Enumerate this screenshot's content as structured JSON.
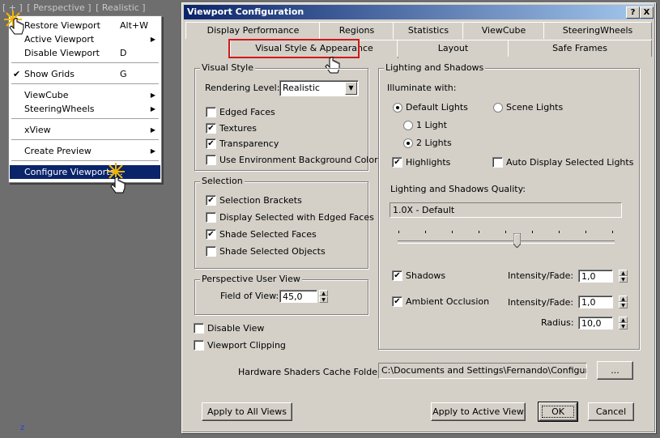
{
  "viewport": {
    "labels": [
      "[ + ]",
      "[ Perspective ]",
      "[ Realistic ]"
    ],
    "axis_label": "z"
  },
  "menu": {
    "items": [
      {
        "label": "Restore Viewport",
        "shortcut": "Alt+W"
      },
      {
        "label": "Active Viewport",
        "submenu_arrow": "▶"
      },
      {
        "label": "Disable Viewport",
        "shortcut": "D"
      },
      {
        "label": "Show Grids",
        "shortcut": "G",
        "check": "✔"
      },
      {
        "label": "ViewCube",
        "submenu_arrow": "▶"
      },
      {
        "label": "SteeringWheels",
        "submenu_arrow": "▶"
      },
      {
        "label": "xView",
        "submenu_arrow": "▶"
      },
      {
        "label": "Create Preview",
        "submenu_arrow": "▶"
      },
      {
        "label": "Configure Viewports..."
      }
    ]
  },
  "dialog": {
    "title": "Viewport Configuration",
    "help_button": "?",
    "close_button": "X",
    "tabs_row1": [
      "Display Performance",
      "Regions",
      "Statistics",
      "ViewCube",
      "SteeringWheels"
    ],
    "tabs_row2": [
      "Visual Style & Appearance",
      "Layout",
      "Safe Frames"
    ],
    "active_tab": "Visual Style & Appearance",
    "visual_style": {
      "group_title": "Visual Style",
      "rendering_level_label": "Rendering Level:",
      "rendering_level_value": "Realistic",
      "dropdown_arrow": "▼",
      "options": [
        {
          "label": "Edged Faces",
          "checked": false
        },
        {
          "label": "Textures",
          "checked": true
        },
        {
          "label": "Transparency",
          "checked": true
        },
        {
          "label": "Use Environment Background Color",
          "checked": false
        }
      ]
    },
    "selection": {
      "group_title": "Selection",
      "options": [
        {
          "label": "Selection Brackets",
          "checked": true
        },
        {
          "label": "Display Selected with Edged Faces",
          "checked": false
        },
        {
          "label": "Shade Selected Faces",
          "checked": true
        },
        {
          "label": "Shade Selected Objects",
          "checked": false
        }
      ]
    },
    "perspective": {
      "group_title": "Perspective User View",
      "fov_label": "Field of View:",
      "fov_value": "45,0"
    },
    "disable_view": {
      "label": "Disable View",
      "checked": false
    },
    "viewport_clipping": {
      "label": "Viewport Clipping",
      "checked": false
    },
    "lighting": {
      "group_title": "Lighting and Shadows",
      "illuminate_label": "Illuminate with:",
      "default_lights": "Default Lights",
      "scene_lights": "Scene Lights",
      "one_light": "1 Light",
      "two_lights": "2 Lights",
      "highlights": {
        "label": "Highlights",
        "checked": true
      },
      "auto_display": {
        "label": "Auto Display Selected Lights",
        "checked": false
      },
      "quality_label": "Lighting and Shadows Quality:",
      "quality_value": "1.0X - Default",
      "quality_slider_fraction": 0.55,
      "shadows": {
        "label": "Shadows",
        "checked": true
      },
      "shadows_intensity_label": "Intensity/Fade:",
      "shadows_intensity_value": "1,0",
      "ao": {
        "label": "Ambient Occlusion",
        "checked": true
      },
      "ao_intensity_label": "Intensity/Fade:",
      "ao_intensity_value": "1,0",
      "radius_label": "Radius:",
      "radius_value": "10,0"
    },
    "cache": {
      "label": "Hardware Shaders Cache Folder:",
      "value": "C:\\Documents and Settings\\Fernando\\Configuración",
      "browse": "..."
    },
    "buttons": {
      "apply_all": "Apply to All Views",
      "apply_active": "Apply to Active View",
      "ok": "OK",
      "cancel": "Cancel"
    },
    "check_glyph": "✔"
  },
  "colors": {
    "title_start": "#0a246a",
    "title_end": "#a6caf0",
    "highlight_box": "#d01818",
    "menu_selection": "#0a246a"
  }
}
